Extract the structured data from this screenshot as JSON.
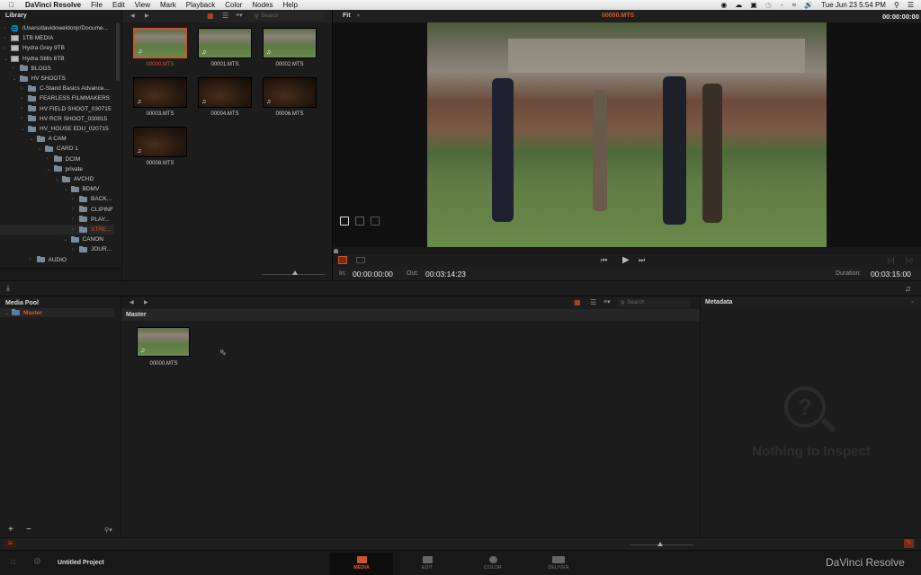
{
  "menubar": {
    "app": "DaVinci Resolve",
    "items": [
      "File",
      "Edit",
      "View",
      "Mark",
      "Playback",
      "Color",
      "Nodes",
      "Help"
    ],
    "clock": "Tue Jun 23  5:54 PM"
  },
  "library": {
    "title": "Library",
    "tree": [
      {
        "label": "/Users/davidoweldonjr/Docume...",
        "type": "globe",
        "depth": 0,
        "expanded": false
      },
      {
        "label": "1TB MEDIA",
        "type": "drive",
        "depth": 0,
        "expanded": false
      },
      {
        "label": "Hydra Grey 9TB",
        "type": "drive",
        "depth": 0,
        "expanded": false
      },
      {
        "label": "Hydra Stills 6TB",
        "type": "drive",
        "depth": 0,
        "expanded": true
      },
      {
        "label": "BLOGS",
        "type": "folder",
        "depth": 1,
        "expanded": false
      },
      {
        "label": "HV SHOOTS",
        "type": "folder",
        "depth": 1,
        "expanded": true
      },
      {
        "label": "C-Stand Basics Advance...",
        "type": "folder",
        "depth": 2,
        "expanded": false
      },
      {
        "label": "FEARLESS FILMMAKERS",
        "type": "folder",
        "depth": 2,
        "expanded": false
      },
      {
        "label": "HV FIELD SHOOT_030715",
        "type": "folder",
        "depth": 2,
        "expanded": false
      },
      {
        "label": "HV RCR SHOOT_030815",
        "type": "folder",
        "depth": 2,
        "expanded": false
      },
      {
        "label": "HV_HOUSE EDU_020715",
        "type": "folder",
        "depth": 2,
        "expanded": true
      },
      {
        "label": "A CAM",
        "type": "folder",
        "depth": 3,
        "expanded": true
      },
      {
        "label": "CARD 1",
        "type": "folder",
        "depth": 4,
        "expanded": true
      },
      {
        "label": "DCIM",
        "type": "folder",
        "depth": 5,
        "expanded": false
      },
      {
        "label": "private",
        "type": "folder",
        "depth": 5,
        "expanded": true
      },
      {
        "label": "AVCHD",
        "type": "folder",
        "depth": 6,
        "expanded": true
      },
      {
        "label": "BDMV",
        "type": "folder",
        "depth": 7,
        "expanded": true
      },
      {
        "label": "BACK...",
        "type": "folder",
        "depth": 8,
        "expanded": false
      },
      {
        "label": "CLIPINF",
        "type": "folder",
        "depth": 8,
        "expanded": false
      },
      {
        "label": "PLAY...",
        "type": "folder",
        "depth": 8,
        "expanded": false
      },
      {
        "label": "STRE...",
        "type": "folder",
        "depth": 8,
        "expanded": false,
        "selected": true
      },
      {
        "label": "CANON",
        "type": "folder",
        "depth": 7,
        "expanded": true
      },
      {
        "label": "JOUR...",
        "type": "folder",
        "depth": 8,
        "expanded": false
      },
      {
        "label": "AUDIO",
        "type": "folder",
        "depth": 3,
        "expanded": false
      }
    ]
  },
  "browser": {
    "search_placeholder": "Search",
    "clips": [
      {
        "name": "00000.MTS",
        "look": "day",
        "selected": true
      },
      {
        "name": "00001.MTS",
        "look": "day"
      },
      {
        "name": "00002.MTS",
        "look": "day"
      },
      {
        "name": "00003.MTS",
        "look": "night"
      },
      {
        "name": "00004.MTS",
        "look": "night"
      },
      {
        "name": "00006.MTS",
        "look": "night"
      },
      {
        "name": "00008.MTS",
        "look": "night"
      }
    ]
  },
  "viewer": {
    "zoom": "Fit",
    "clip_name": "00000.MTS",
    "timecode": "00:00:00:00",
    "in_label": "In:",
    "in_value": "00:00:00:00",
    "out_label": "Out:",
    "out_value": "00:03:14:23",
    "duration_label": "Duration:",
    "duration_value": "00:03:15:00"
  },
  "media_pool": {
    "title": "Media Pool",
    "bins": [
      {
        "label": "Master",
        "selected": true
      }
    ],
    "bin_header": "Master",
    "search_placeholder": "Search",
    "clips": [
      {
        "name": "00000.MTS"
      }
    ]
  },
  "metadata": {
    "title": "Metadata",
    "empty_text": "Nothing to Inspect"
  },
  "bottom": {
    "project": "Untitled Project",
    "tabs": [
      {
        "label": "MEDIA",
        "active": true
      },
      {
        "label": "EDIT"
      },
      {
        "label": "COLOR"
      },
      {
        "label": "DELIVER"
      }
    ],
    "brand": "DaVinci Resolve"
  },
  "colors": {
    "accent": "#e0532b"
  }
}
